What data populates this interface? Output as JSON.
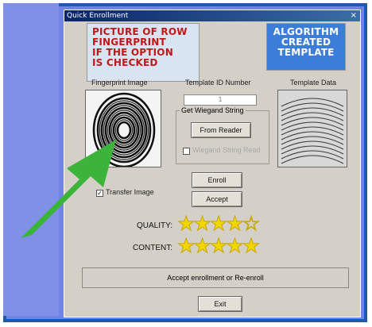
{
  "window": {
    "title": "Quick Enrollment"
  },
  "callouts": {
    "left": [
      "PICTURE OF ROW",
      "FINGERPRINT",
      "IF THE OPTION",
      "IS CHECKED"
    ],
    "right": [
      "ALGORITHM",
      "CREATED",
      "TEMPLATE"
    ]
  },
  "labels": {
    "fingerprint_image": "Fingerprint Image",
    "template_id": "Template ID Number",
    "template_data": "Template Data"
  },
  "template_id_value": "1",
  "wiegand": {
    "group_title": "Get Wiegand String",
    "from_reader_label": "From Reader",
    "wiegand_read_label": "Wiegand String Read"
  },
  "buttons": {
    "enroll": "Enroll",
    "accept": "Accept",
    "exit": "Exit"
  },
  "transfer_image": {
    "label": "Transfer Image",
    "checked": true
  },
  "ratings": {
    "quality": {
      "label": "QUALITY:",
      "value": 4,
      "max": 5
    },
    "content": {
      "label": "CONTENT:",
      "value": 5,
      "max": 5
    }
  },
  "status_text": "Accept enrollment or Re-enroll",
  "colors": {
    "window_title": "#0A246A",
    "callout_text": "#C01818",
    "callout_right_bg": "#3C7DD9",
    "arrow": "#3CB43A",
    "star": "#F2D600"
  }
}
